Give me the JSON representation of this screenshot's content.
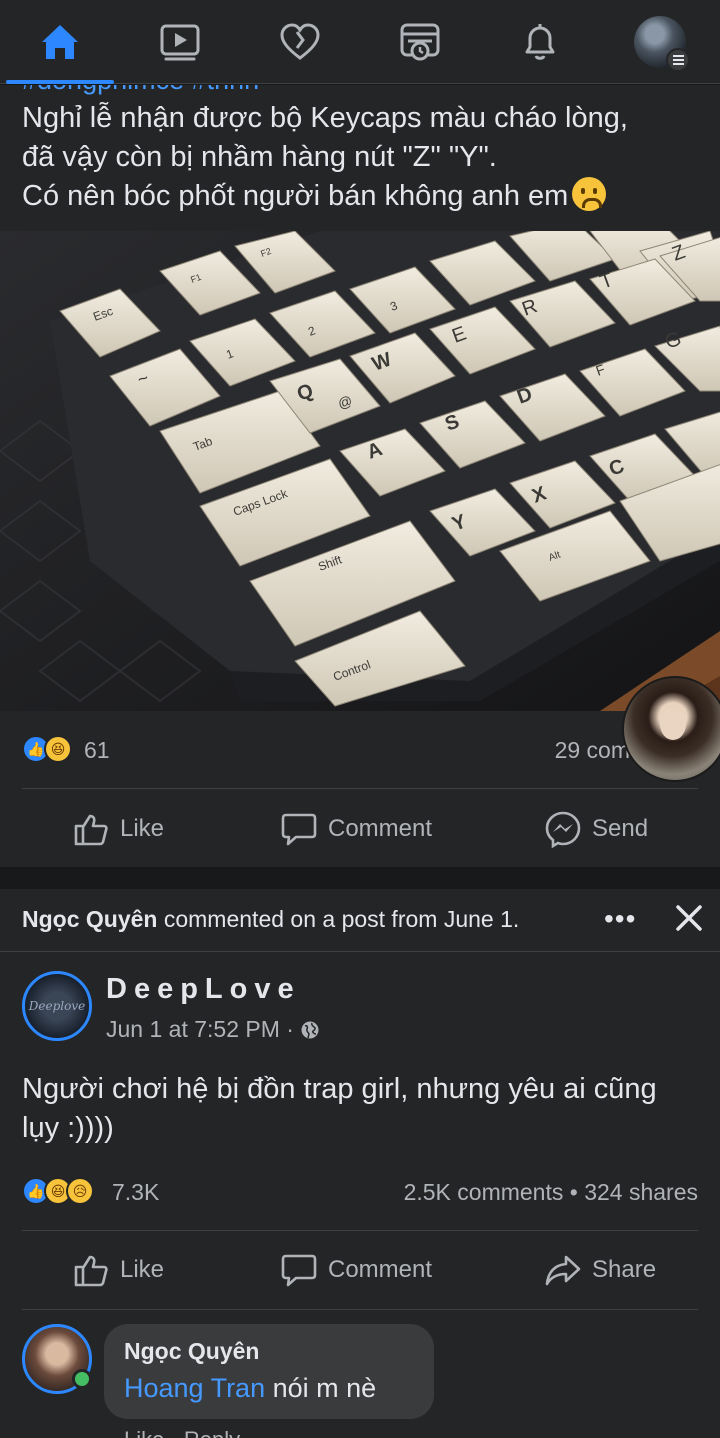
{
  "nav": {
    "items": [
      {
        "name": "home",
        "icon": "home-icon",
        "active": true
      },
      {
        "name": "watch",
        "icon": "video-icon",
        "active": false
      },
      {
        "name": "dating",
        "icon": "heart-icon",
        "active": false
      },
      {
        "name": "memories",
        "icon": "memories-icon",
        "active": false
      },
      {
        "name": "notifications",
        "icon": "bell-icon",
        "active": false
      },
      {
        "name": "menu",
        "icon": "profile-menu-icon",
        "active": false
      }
    ],
    "accent": "#2d88ff"
  },
  "post1": {
    "link_cut": "#dongphimce #trinh",
    "text_lines": [
      "Nghỉ lễ nhận được bộ Keycaps màu cháo lòng,",
      "đã vậy còn bị nhầm hàng nút \"Z\"  \"Y\".",
      "Có nên bóc phốt người bán không anh em"
    ],
    "reactions": [
      "like",
      "haha"
    ],
    "reaction_count": "61",
    "comment_count": "29 com",
    "actions": {
      "like": "Like",
      "comment": "Comment",
      "send": "Send"
    },
    "keys": {
      "esc": "Esc",
      "f1": "F1",
      "f2": "F2",
      "tilde": "~",
      "one": "1",
      "two": "2",
      "three": "3",
      "q": "Q",
      "at": "@",
      "w": "W",
      "e": "E",
      "r": "R",
      "t": "T",
      "z": "Z",
      "a": "A",
      "s": "S",
      "d": "D",
      "f": "F",
      "g": "G",
      "x": "X",
      "c": "C",
      "y": "Y",
      "tab": "Tab",
      "caps": "Caps Lock",
      "shift": "Shift",
      "control": "Control",
      "alt": "Alt"
    }
  },
  "post2": {
    "story_name": "Ngọc Quyên",
    "story_rest": " commented on a post from June 1.",
    "more": "•••",
    "page_name": "DeepLove",
    "avatar_text": "Deeplove",
    "time": "Jun 1 at 7:52 PM ·",
    "text_lines": [
      "Người chơi hệ bị đồn trap girl, nhưng yêu ai cũng",
      "lụy :))))"
    ],
    "reactions": [
      "like",
      "haha",
      "sad"
    ],
    "reaction_count": "7.3K",
    "stats": "2.5K comments • 324 shares",
    "actions": {
      "like": "Like",
      "comment": "Comment",
      "share": "Share"
    },
    "comment": {
      "author": "Ngọc Quyên",
      "mention": "Hoang Tran",
      "text": " nói m nè"
    },
    "cut_bottom": "Like · Reply"
  },
  "colors": {
    "bg": "#18191a",
    "card": "#242526",
    "text": "#e4e6eb",
    "muted": "#b0b3b8",
    "link": "#4599ff",
    "online": "#45bd62"
  }
}
